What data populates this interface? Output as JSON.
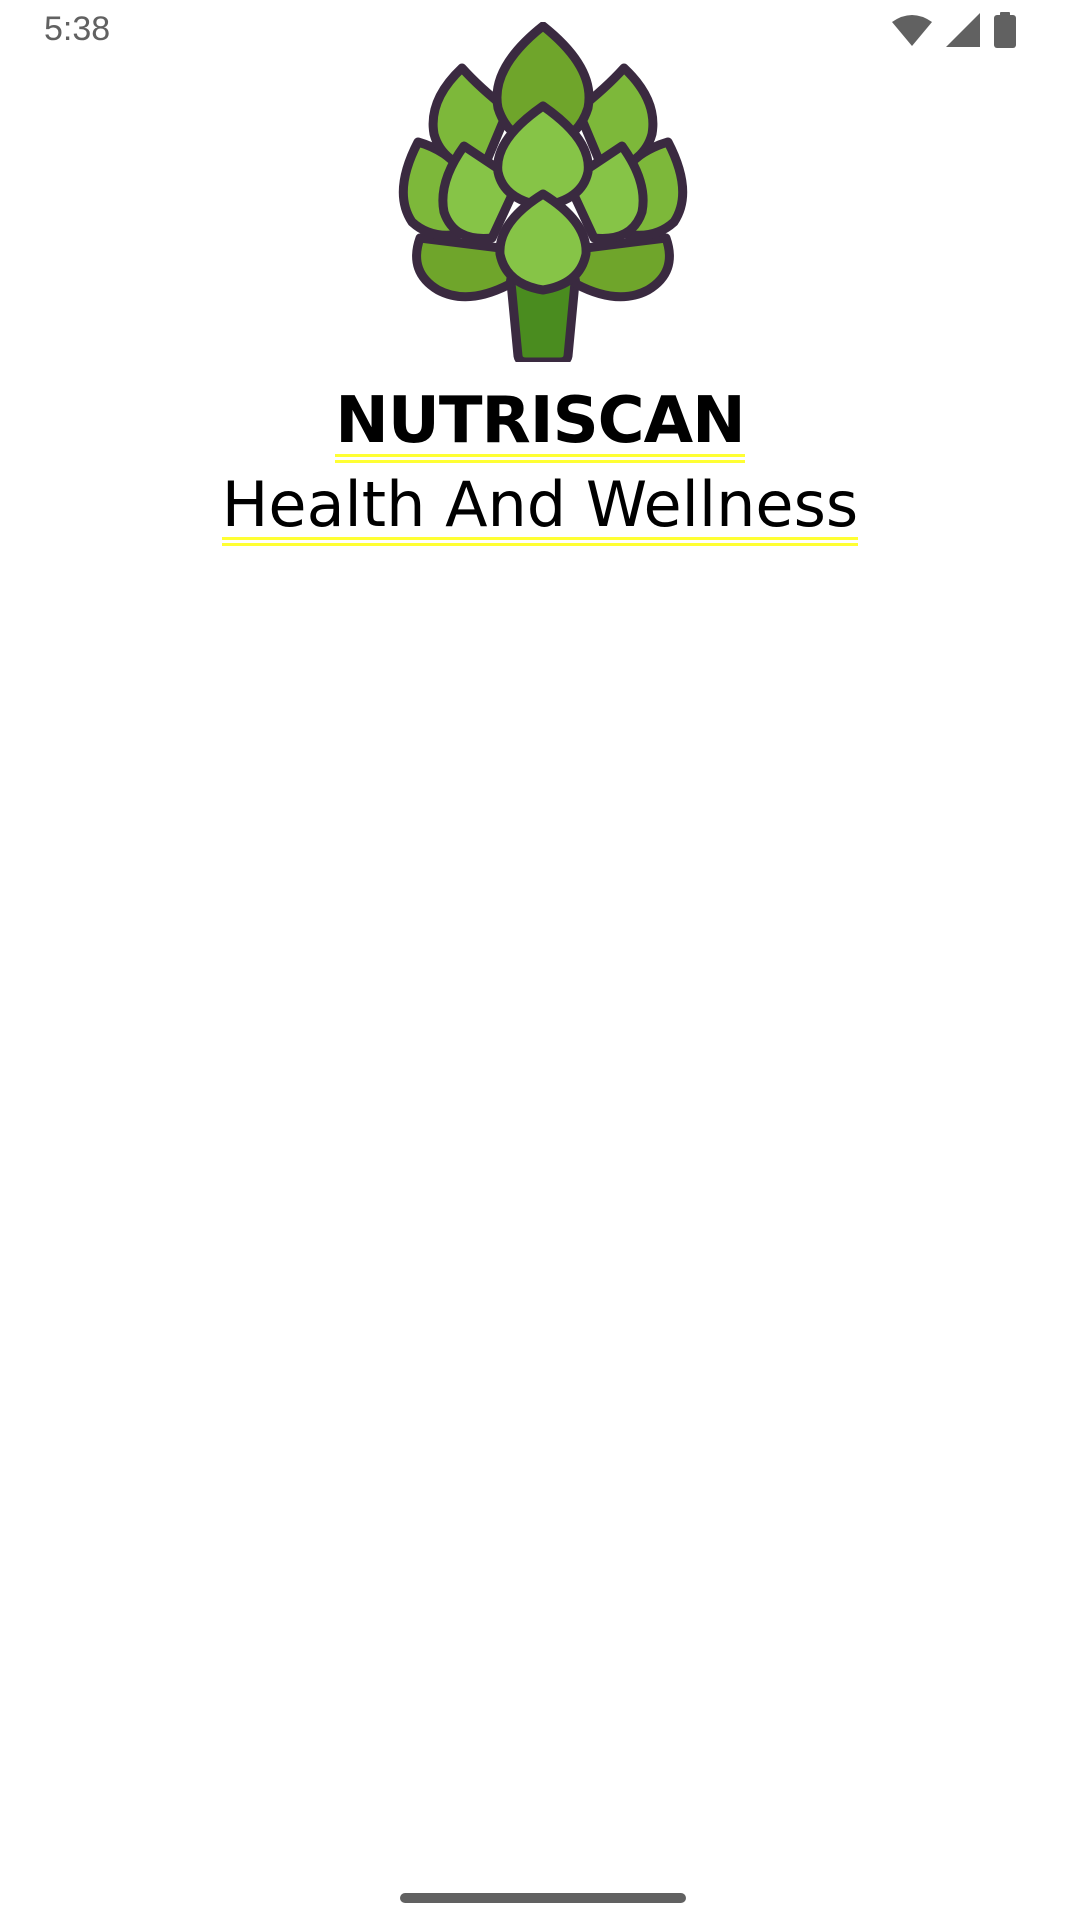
{
  "status_bar": {
    "time": "5:38",
    "icons": [
      "wifi-icon",
      "cellular-signal-icon",
      "battery-icon"
    ]
  },
  "logo": {
    "icon": "artichoke-icon",
    "colors": {
      "outline": "#3a2a40",
      "leaf_dark": "#6fa52b",
      "leaf_light": "#86c447",
      "stem": "#4a8c1f"
    }
  },
  "app": {
    "name": "NUTRISCAN",
    "tagline": "Health And Wellness"
  },
  "colors": {
    "background": "#ffffff",
    "text": "#000000",
    "underline": "#ffff33",
    "system_gray": "#616161"
  }
}
